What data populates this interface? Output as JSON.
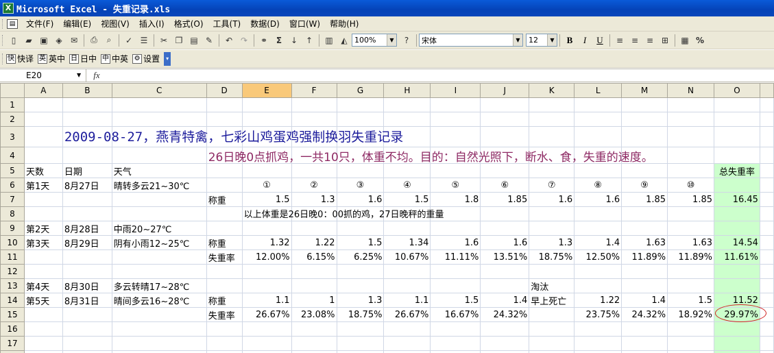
{
  "window": {
    "title": "Microsoft Excel - 失重记录.xls",
    "app_icon": "excel-icon"
  },
  "menu": [
    "文件(F)",
    "编辑(E)",
    "视图(V)",
    "插入(I)",
    "格式(O)",
    "工具(T)",
    "数据(D)",
    "窗口(W)",
    "帮助(H)"
  ],
  "toolbar": {
    "zoom": "100%",
    "font_name": "宋体",
    "font_size": "12",
    "bold": "B",
    "italic": "I",
    "underline": "U",
    "percent": "%",
    "sigma": "Σ"
  },
  "ime_toolbar": [
    {
      "icon": "快",
      "label": "快译"
    },
    {
      "icon": "英",
      "label": "英中"
    },
    {
      "icon": "日",
      "label": "日中"
    },
    {
      "icon": "中",
      "label": "中英"
    },
    {
      "icon": "⚙",
      "label": "设置"
    }
  ],
  "formula_bar": {
    "name_box": "E20",
    "fx": "fx",
    "content": ""
  },
  "columns": [
    "A",
    "B",
    "C",
    "D",
    "E",
    "F",
    "G",
    "H",
    "I",
    "J",
    "K",
    "L",
    "M",
    "N",
    "O"
  ],
  "selected_column": "E",
  "rows": {
    "r3": {
      "title": "2009-08-27，燕青特禽，七彩山鸡蛋鸡强制换羽失重记录"
    },
    "r4": {
      "subtitle": "26日晚0点抓鸡，一共10只，体重不均。目的：自然光照下，断水、食，失重的速度。"
    },
    "r5": {
      "a": "天数",
      "b": "日期",
      "c": "天气",
      "o": "总失重率"
    },
    "r6": {
      "a": "第1天",
      "b": "8月27日",
      "c": "晴转多云21~30℃",
      "nums": [
        "①",
        "②",
        "③",
        "④",
        "⑤",
        "⑥",
        "⑦",
        "⑧",
        "⑨",
        "⑩"
      ]
    },
    "r7": {
      "d": "称重",
      "vals": [
        "1.5",
        "1.3",
        "1.6",
        "1.5",
        "1.8",
        "1.85",
        "1.6",
        "1.6",
        "1.85",
        "1.85"
      ],
      "o": "16.45"
    },
    "r8": {
      "note": "以上体重是26日晚0：00抓的鸡，27日晚秤的重量"
    },
    "r9": {
      "a": "第2天",
      "b": "8月28日",
      "c": "中雨20~27℃"
    },
    "r10": {
      "a": "第3天",
      "b": "8月29日",
      "c": "阴有小雨12~25℃",
      "d": "称重",
      "vals": [
        "1.32",
        "1.22",
        "1.5",
        "1.34",
        "1.6",
        "1.6",
        "1.3",
        "1.4",
        "1.63",
        "1.63"
      ],
      "o": "14.54"
    },
    "r11": {
      "d": "失重率",
      "vals": [
        "12.00%",
        "6.15%",
        "6.25%",
        "10.67%",
        "11.11%",
        "13.51%",
        "18.75%",
        "12.50%",
        "11.89%",
        "11.89%"
      ],
      "o": "11.61%"
    },
    "r13": {
      "a": "第4天",
      "b": "8月30日",
      "c": "多云转晴17~28℃",
      "k": "淘汰"
    },
    "r14": {
      "a": "第5天",
      "b": "8月31日",
      "c": "晴间多云16~28℃",
      "d": "称重",
      "vals": [
        "1.1",
        "1",
        "1.3",
        "1.1",
        "1.5",
        "1.4",
        "早上死亡",
        "1.22",
        "1.4",
        "1.5"
      ],
      "o": "11.52"
    },
    "r15": {
      "d": "失重率",
      "vals": [
        "26.67%",
        "23.08%",
        "18.75%",
        "26.67%",
        "16.67%",
        "24.32%",
        "",
        "23.75%",
        "24.32%",
        "18.92%"
      ],
      "o": "29.97%"
    }
  },
  "colors": {
    "title_blue": "#1d1d9c",
    "subtitle_purple": "#8e2a64",
    "total_green": "#ccffcc",
    "annotation_red": "#d02020"
  }
}
